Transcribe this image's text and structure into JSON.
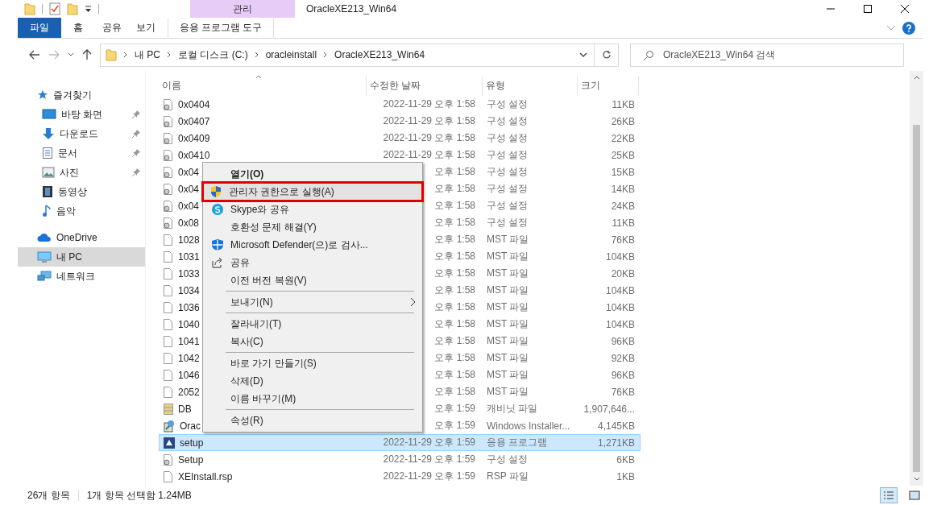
{
  "window": {
    "title": "OracleXE213_Win64",
    "context_group": "관리"
  },
  "ribbon_tabs": [
    {
      "label": "파일",
      "kind": "file"
    },
    {
      "label": "홈",
      "kind": "normal"
    },
    {
      "label": "공유",
      "kind": "normal"
    },
    {
      "label": "보기",
      "kind": "normal"
    },
    {
      "label": "응용 프로그램 도구",
      "kind": "context"
    }
  ],
  "address": {
    "path": [
      "내 PC",
      "로컬 디스크 (C:)",
      "oracleinstall",
      "OracleXE213_Win64"
    ]
  },
  "search": {
    "placeholder": "OracleXE213_Win64 검색"
  },
  "sidebar": {
    "items": [
      {
        "label": "즐겨찾기",
        "selected": false,
        "children": [
          {
            "label": "바탕 화면",
            "pinned": true,
            "selected": false
          },
          {
            "label": "다운로드",
            "pinned": true,
            "selected": false
          },
          {
            "label": "문서",
            "pinned": true,
            "selected": false
          },
          {
            "label": "사진",
            "pinned": true,
            "selected": false
          },
          {
            "label": "동영상",
            "pinned": false,
            "selected": false
          },
          {
            "label": "음악",
            "pinned": false,
            "selected": false
          }
        ]
      },
      {
        "label": "OneDrive",
        "selected": false
      },
      {
        "label": "내 PC",
        "selected": true
      },
      {
        "label": "네트워크",
        "selected": false
      }
    ]
  },
  "files": {
    "columns": [
      "이름",
      "수정한 날짜",
      "유형",
      "크기"
    ],
    "rows": [
      {
        "name": "0x0404",
        "modified": "2022-11-29 오후 1:58",
        "type": "구성 설정",
        "size": "11KB",
        "kind": "config",
        "selected": false
      },
      {
        "name": "0x0407",
        "modified": "2022-11-29 오후 1:58",
        "type": "구성 설정",
        "size": "26KB",
        "kind": "config",
        "selected": false
      },
      {
        "name": "0x0409",
        "modified": "2022-11-29 오후 1:58",
        "type": "구성 설정",
        "size": "22KB",
        "kind": "config",
        "selected": false
      },
      {
        "name": "0x0410",
        "modified": "2022-11-29 오후 1:58",
        "type": "구성 설정",
        "size": "25KB",
        "kind": "config",
        "selected": false
      },
      {
        "name": "0x04",
        "modified": "오후 1:58",
        "type": "구성 설정",
        "size": "15KB",
        "kind": "config",
        "selected": false
      },
      {
        "name": "0x04",
        "modified": "오후 1:58",
        "type": "구성 설정",
        "size": "14KB",
        "kind": "config",
        "selected": false
      },
      {
        "name": "0x04",
        "modified": "오후 1:58",
        "type": "구성 설정",
        "size": "24KB",
        "kind": "config",
        "selected": false
      },
      {
        "name": "0x08",
        "modified": "오후 1:58",
        "type": "구성 설정",
        "size": "11KB",
        "kind": "config",
        "selected": false
      },
      {
        "name": "1028",
        "modified": "오후 1:58",
        "type": "MST 파일",
        "size": "76KB",
        "kind": "file",
        "selected": false
      },
      {
        "name": "1031",
        "modified": "오후 1:58",
        "type": "MST 파일",
        "size": "104KB",
        "kind": "file",
        "selected": false
      },
      {
        "name": "1033",
        "modified": "오후 1:58",
        "type": "MST 파일",
        "size": "20KB",
        "kind": "file",
        "selected": false
      },
      {
        "name": "1034",
        "modified": "오후 1:58",
        "type": "MST 파일",
        "size": "104KB",
        "kind": "file",
        "selected": false
      },
      {
        "name": "1036",
        "modified": "오후 1:58",
        "type": "MST 파일",
        "size": "104KB",
        "kind": "file",
        "selected": false
      },
      {
        "name": "1040",
        "modified": "오후 1:58",
        "type": "MST 파일",
        "size": "104KB",
        "kind": "file",
        "selected": false
      },
      {
        "name": "1041",
        "modified": "오후 1:58",
        "type": "MST 파일",
        "size": "96KB",
        "kind": "file",
        "selected": false
      },
      {
        "name": "1042",
        "modified": "오후 1:58",
        "type": "MST 파일",
        "size": "92KB",
        "kind": "file",
        "selected": false
      },
      {
        "name": "1046",
        "modified": "오후 1:58",
        "type": "MST 파일",
        "size": "96KB",
        "kind": "file",
        "selected": false
      },
      {
        "name": "2052",
        "modified": "오후 1:58",
        "type": "MST 파일",
        "size": "76KB",
        "kind": "file",
        "selected": false
      },
      {
        "name": "DB",
        "modified": "오후 1:59",
        "type": "캐비닛 파일",
        "size": "1,907,646...",
        "kind": "cabinet",
        "selected": false
      },
      {
        "name": "Orac",
        "modified": "오후 1:59",
        "type": "Windows Installer...",
        "size": "4,145KB",
        "kind": "installer",
        "selected": false
      },
      {
        "name": "setup",
        "modified": "2022-11-29 오후 1:59",
        "type": "응용 프로그램",
        "size": "1,271KB",
        "kind": "app",
        "selected": true
      },
      {
        "name": "Setup",
        "modified": "2022-11-29 오후 1:59",
        "type": "구성 설정",
        "size": "6KB",
        "kind": "config",
        "selected": false
      },
      {
        "name": "XEInstall.rsp",
        "modified": "2022-11-29 오후 1:59",
        "type": "RSP 파일",
        "size": "1KB",
        "kind": "file",
        "selected": false
      }
    ]
  },
  "context_menu": {
    "items": [
      {
        "kind": "item",
        "label": "열기(O)",
        "default": true,
        "highlighted": false
      },
      {
        "kind": "item",
        "label": "관리자 권한으로 실행(A)",
        "default": false,
        "highlighted": true
      },
      {
        "kind": "item",
        "label": "Skype와 공유",
        "default": false,
        "highlighted": false
      },
      {
        "kind": "item",
        "label": "호환성 문제 해결(Y)",
        "default": false,
        "highlighted": false
      },
      {
        "kind": "item",
        "label": "Microsoft Defender(으)로 검사...",
        "default": false,
        "highlighted": false
      },
      {
        "kind": "item",
        "label": "공유",
        "default": false,
        "highlighted": false
      },
      {
        "kind": "item",
        "label": "이전 버전 복원(V)",
        "default": false,
        "highlighted": false
      },
      {
        "kind": "separator"
      },
      {
        "kind": "item",
        "label": "보내기(N)",
        "default": false,
        "highlighted": false,
        "submenu": true
      },
      {
        "kind": "separator"
      },
      {
        "kind": "item",
        "label": "잘라내기(T)",
        "default": false,
        "highlighted": false
      },
      {
        "kind": "item",
        "label": "복사(C)",
        "default": false,
        "highlighted": false
      },
      {
        "kind": "separator"
      },
      {
        "kind": "item",
        "label": "바로 가기 만들기(S)",
        "default": false,
        "highlighted": false
      },
      {
        "kind": "item",
        "label": "삭제(D)",
        "default": false,
        "highlighted": false
      },
      {
        "kind": "item",
        "label": "이름 바꾸기(M)",
        "default": false,
        "highlighted": false
      },
      {
        "kind": "separator"
      },
      {
        "kind": "item",
        "label": "속성(R)",
        "default": false,
        "highlighted": false
      }
    ]
  },
  "status_bar": {
    "count": "26개 항목",
    "selection": "1개 항목 선택함 1.24MB"
  }
}
